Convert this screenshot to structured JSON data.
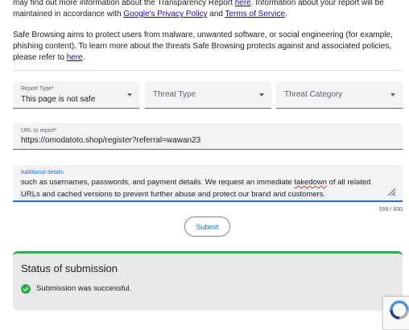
{
  "intro": {
    "line1_a": "may find out more information about the Transparency Report ",
    "line1_link": "here",
    "line1_b": ". Information about your report will be",
    "line2_a": "maintained in accordance with ",
    "privacy_link": "Google's Privacy Policy",
    "line2_and": " and ",
    "terms_link": "Terms of Service",
    "line2_end": "."
  },
  "about": {
    "text": "Safe Browsing aims to protect users from malware, unwanted software, or social engineering (for example, phishing content). To learn more about the threats Safe Browsing protects against and associated policies, please refer to ",
    "link": "here",
    "end": "."
  },
  "report_type": {
    "label": "Report Type*",
    "value": "This page is not safe"
  },
  "threat_type": {
    "placeholder": "Threat Type"
  },
  "threat_category": {
    "placeholder": "Threat Category"
  },
  "url_field": {
    "label": "URL to report*",
    "value": "https://omodatoto.shop/register?referral=wawan23"
  },
  "details": {
    "label": "Additional details",
    "line1_a": "such as usernames, passwords, and payment details. We request an immediate ",
    "line1_misspelled": "takedown",
    "line1_b": " of all related",
    "line2": "URLs and cached versions to prevent further abuse and protect our brand and customers.",
    "counter": "599 / 800"
  },
  "submit_label": "Submit",
  "status": {
    "title": "Status of submission",
    "message": "Submission was successful."
  },
  "colors": {
    "accent": "#1a73e8",
    "success": "#34a853",
    "link": "#1a0dab"
  },
  "icons": [
    "dropdown-caret-icon",
    "resize-handle-icon",
    "check-circle-icon",
    "recaptcha-icon"
  ]
}
